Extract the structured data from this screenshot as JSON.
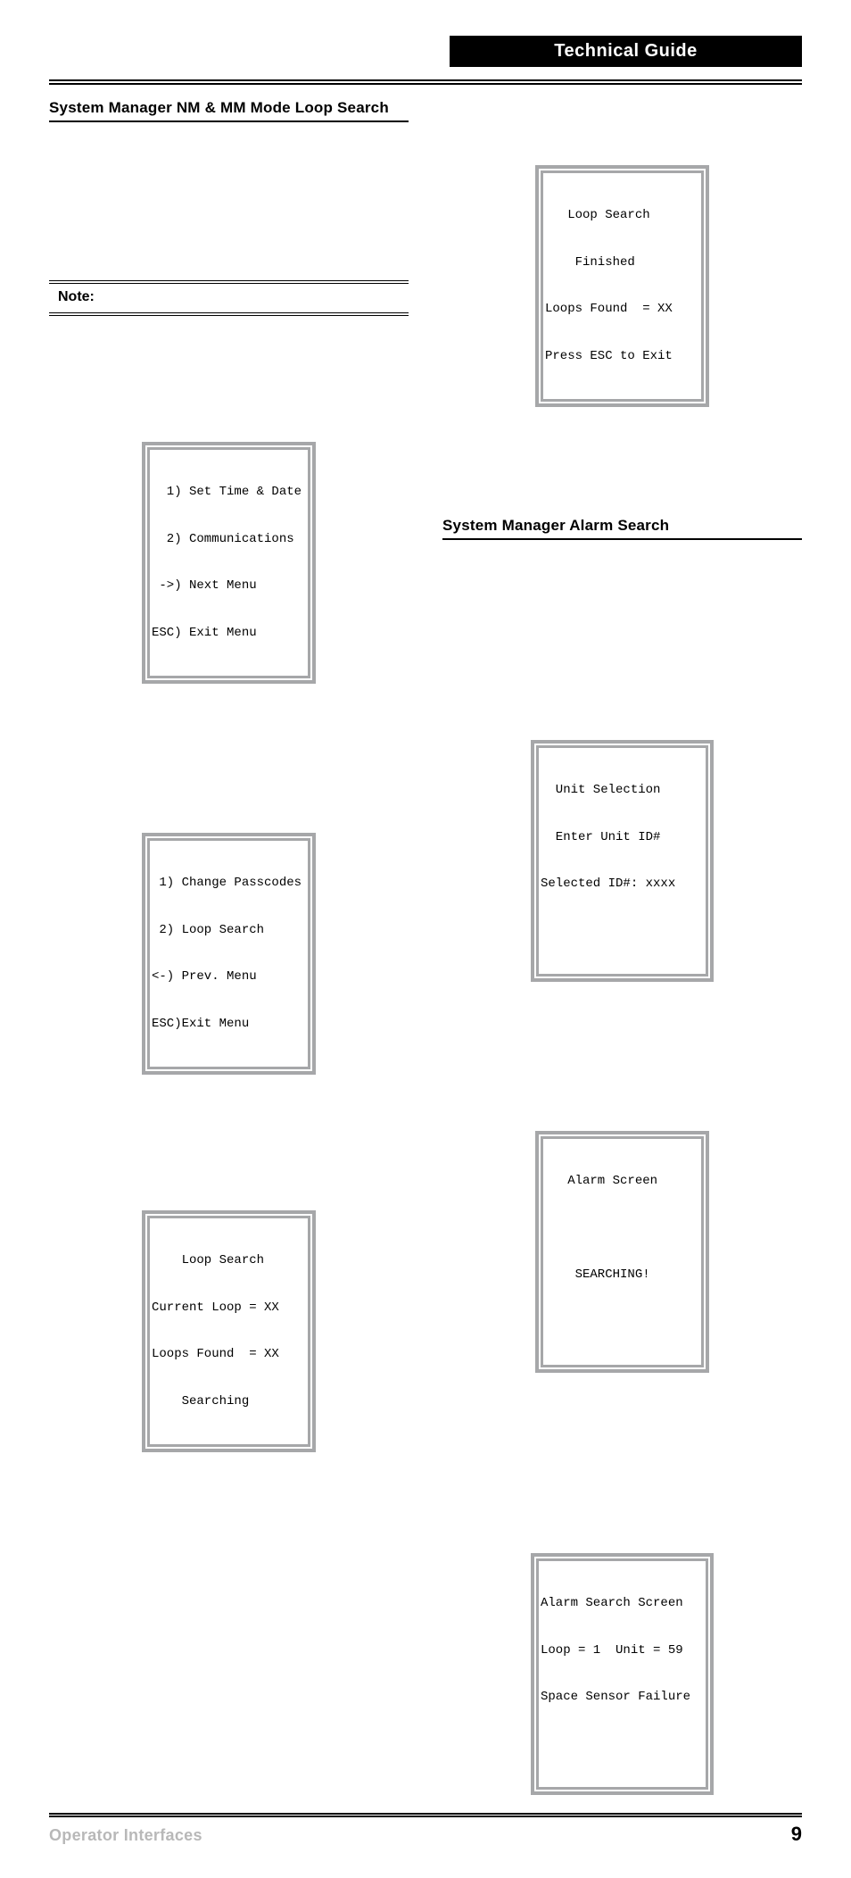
{
  "header": {
    "title": "Technical Guide"
  },
  "left": {
    "section1_heading": "System Manager NM & MM Mode Loop Search",
    "note_label": "Note:",
    "lcd_menu1": {
      "l1": "  1) Set Time & Date",
      "l2": "  2) Communications",
      "l3": " ->) Next Menu",
      "l4": "ESC) Exit Menu"
    },
    "lcd_menu2": {
      "l1": " 1) Change Passcodes",
      "l2": " 2) Loop Search",
      "l3": "<-) Prev. Menu",
      "l4": "ESC)Exit Menu"
    },
    "lcd_loop_searching": {
      "l1": "    Loop Search",
      "l2": "Current Loop = XX",
      "l3": "Loops Found  = XX",
      "l4": "    Searching"
    }
  },
  "right": {
    "lcd_loop_finished": {
      "l1": "   Loop Search",
      "l2": "    Finished",
      "l3": "Loops Found  = XX",
      "l4": "Press ESC to Exit"
    },
    "section2_heading": "System Manager Alarm Search",
    "lcd_unit_selection": {
      "l1": "  Unit Selection",
      "l2": "  Enter Unit ID#",
      "l3": "Selected ID#: xxxx",
      "l4": " "
    },
    "lcd_alarm_searching": {
      "l1": "   Alarm Screen",
      "l2": " ",
      "l3": "    SEARCHING!",
      "l4": " "
    },
    "lcd_alarm_result": {
      "l1": "Alarm Search Screen",
      "l2": "Loop = 1  Unit = 59",
      "l3": "Space Sensor Failure",
      "l4": " "
    }
  },
  "footer": {
    "left": "Operator Interfaces",
    "page": "9"
  }
}
